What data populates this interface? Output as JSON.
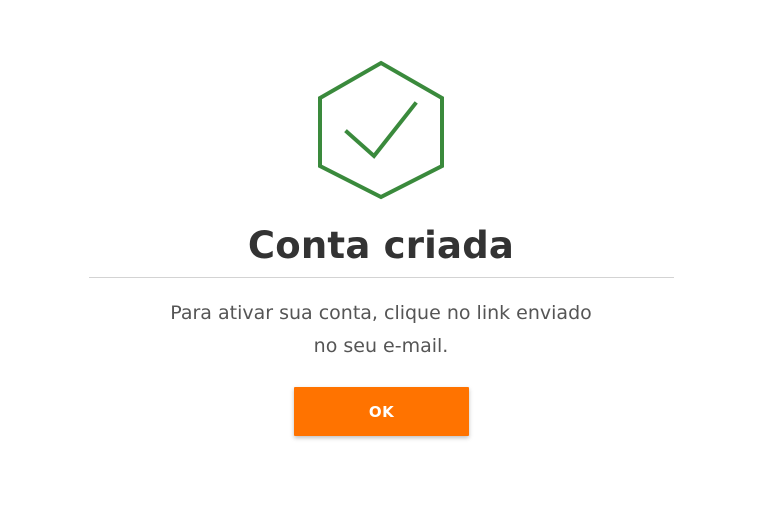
{
  "dialog": {
    "icon": "hexagon-check-icon",
    "title": "Conta criada",
    "message_line1": "Para ativar sua conta, clique no link enviado",
    "message_line2": "no seu e-mail.",
    "ok_label": "OK"
  },
  "colors": {
    "icon_green": "#3a8a3c",
    "button_orange": "#ff7300",
    "title_text": "#333333",
    "body_text": "#555555",
    "divider": "#d3d3d3"
  }
}
